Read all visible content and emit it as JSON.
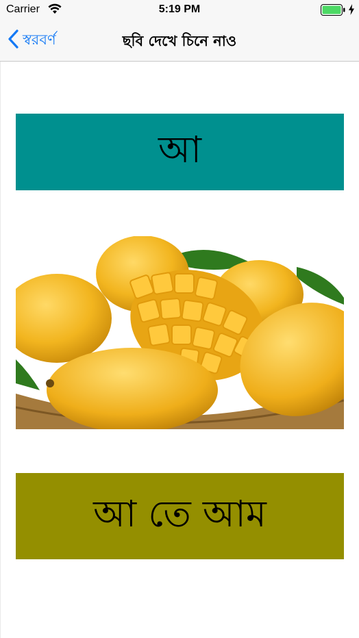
{
  "status_bar": {
    "carrier": "Carrier",
    "time": "5:19 PM",
    "icons": [
      "wifi-icon",
      "battery-icon",
      "charging-bolt-icon"
    ],
    "battery_color": "#4cd964"
  },
  "nav": {
    "back_label": "স্বরবর্ণ",
    "title": "ছবি দেখে চিনে নাও",
    "back_icon": "chevron-left-icon",
    "accent_color": "#1479f5"
  },
  "card": {
    "letter": "আ",
    "letter_bg": "#00908f",
    "image_subject": "mangoes",
    "word": "আ তে আম",
    "word_bg": "#948f00"
  }
}
